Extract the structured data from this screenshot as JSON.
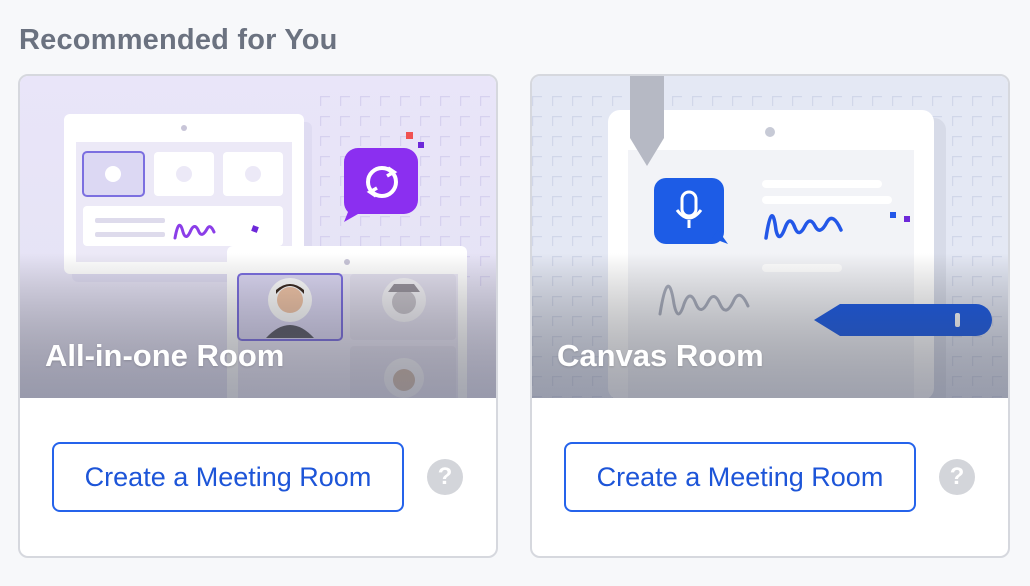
{
  "section": {
    "title": "Recommended for You"
  },
  "cards": [
    {
      "title": "All-in-one Room",
      "button_label": "Create a Meeting Room",
      "help_glyph": "?",
      "illustration": "all-in-one-room-illustration"
    },
    {
      "title": "Canvas Room",
      "button_label": "Create a Meeting Room",
      "help_glyph": "?",
      "illustration": "canvas-room-illustration"
    }
  ],
  "colors": {
    "accent": "#2563eb",
    "purple": "#7c3aed",
    "heading": "#6b7280"
  }
}
